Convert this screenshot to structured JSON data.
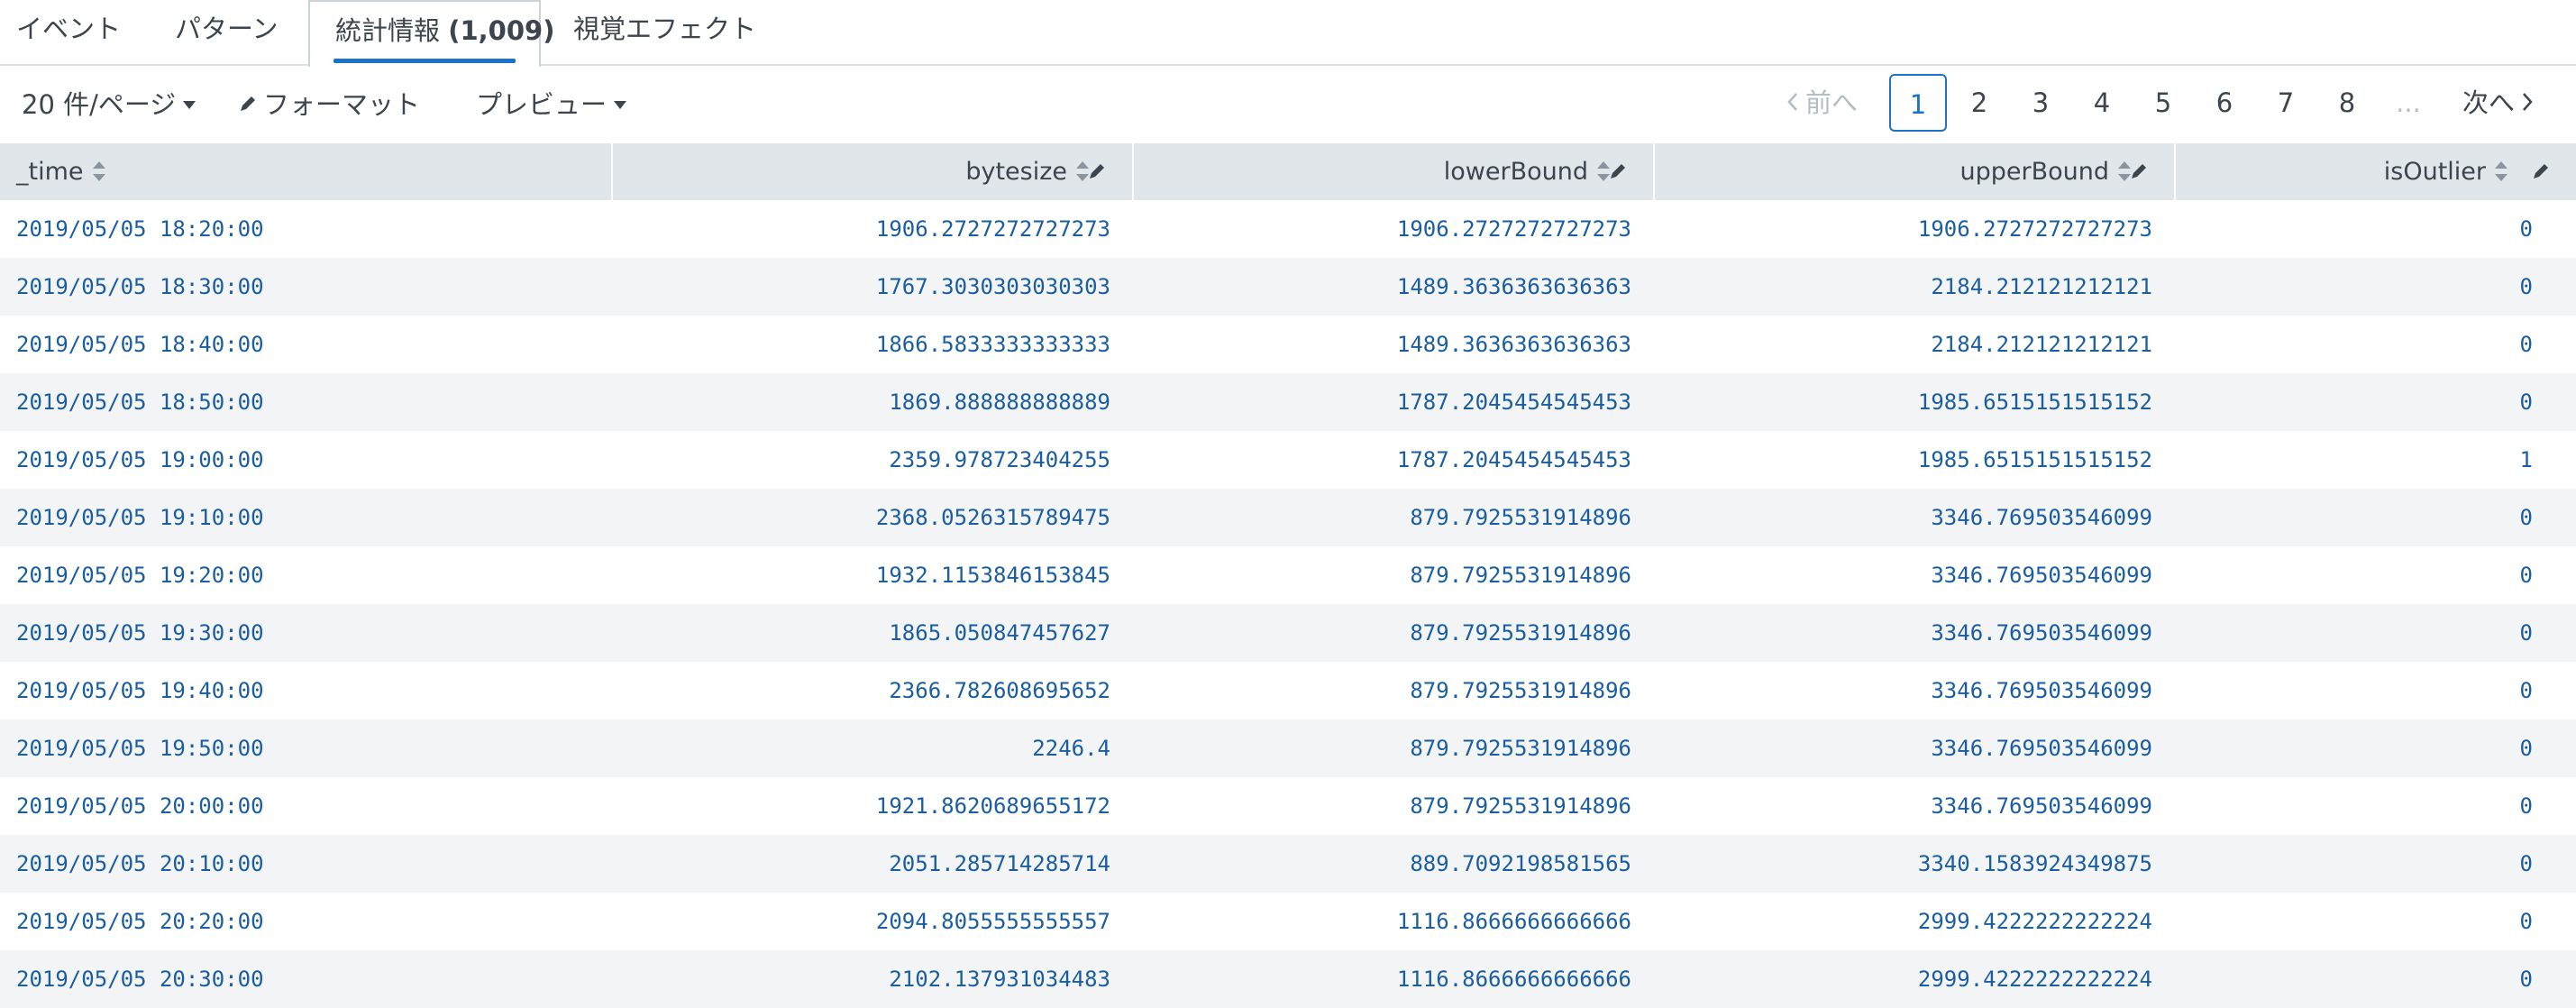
{
  "tabs": [
    {
      "label": "イベント"
    },
    {
      "label": "パターン"
    },
    {
      "label": "統計情報",
      "count": "(1,009)"
    },
    {
      "label": "視覚エフェクト"
    }
  ],
  "toolbar": {
    "per_page": "20 件/ページ",
    "format": "フォーマット",
    "preview": "プレビュー"
  },
  "pager": {
    "prev": "前へ",
    "pages": [
      "1",
      "2",
      "3",
      "4",
      "5",
      "6",
      "7",
      "8"
    ],
    "ellipsis": "...",
    "next": "次へ",
    "current": "1"
  },
  "columns": [
    "_time",
    "bytesize",
    "lowerBound",
    "upperBound",
    "isOutlier"
  ],
  "rows": [
    [
      "2019/05/05 18:20:00",
      "1906.2727272727273",
      "1906.2727272727273",
      "1906.2727272727273",
      "0"
    ],
    [
      "2019/05/05 18:30:00",
      "1767.3030303030303",
      "1489.3636363636363",
      "2184.212121212121",
      "0"
    ],
    [
      "2019/05/05 18:40:00",
      "1866.5833333333333",
      "1489.3636363636363",
      "2184.212121212121",
      "0"
    ],
    [
      "2019/05/05 18:50:00",
      "1869.888888888889",
      "1787.2045454545453",
      "1985.6515151515152",
      "0"
    ],
    [
      "2019/05/05 19:00:00",
      "2359.978723404255",
      "1787.2045454545453",
      "1985.6515151515152",
      "1"
    ],
    [
      "2019/05/05 19:10:00",
      "2368.0526315789475",
      "879.7925531914896",
      "3346.769503546099",
      "0"
    ],
    [
      "2019/05/05 19:20:00",
      "1932.1153846153845",
      "879.7925531914896",
      "3346.769503546099",
      "0"
    ],
    [
      "2019/05/05 19:30:00",
      "1865.050847457627",
      "879.7925531914896",
      "3346.769503546099",
      "0"
    ],
    [
      "2019/05/05 19:40:00",
      "2366.782608695652",
      "879.7925531914896",
      "3346.769503546099",
      "0"
    ],
    [
      "2019/05/05 19:50:00",
      "2246.4",
      "879.7925531914896",
      "3346.769503546099",
      "0"
    ],
    [
      "2019/05/05 20:00:00",
      "1921.8620689655172",
      "879.7925531914896",
      "3346.769503546099",
      "0"
    ],
    [
      "2019/05/05 20:10:00",
      "2051.285714285714",
      "889.7092198581565",
      "3340.1583924349875",
      "0"
    ],
    [
      "2019/05/05 20:20:00",
      "2094.8055555555557",
      "1116.8666666666666",
      "2999.4222222222224",
      "0"
    ],
    [
      "2019/05/05 20:30:00",
      "2102.137931034483",
      "1116.8666666666666",
      "2999.4222222222224",
      "0"
    ]
  ],
  "colors": {
    "accent": "#1a73c8",
    "cell_text": "#1a5ea1",
    "header_bg": "#e1e6eb",
    "row_alt_bg": "#f2f4f5"
  },
  "icons": {
    "sort": "sort-icon",
    "edit": "pencil-icon",
    "dropdown": "caret-down-icon",
    "prev": "chevron-left-icon"
  }
}
